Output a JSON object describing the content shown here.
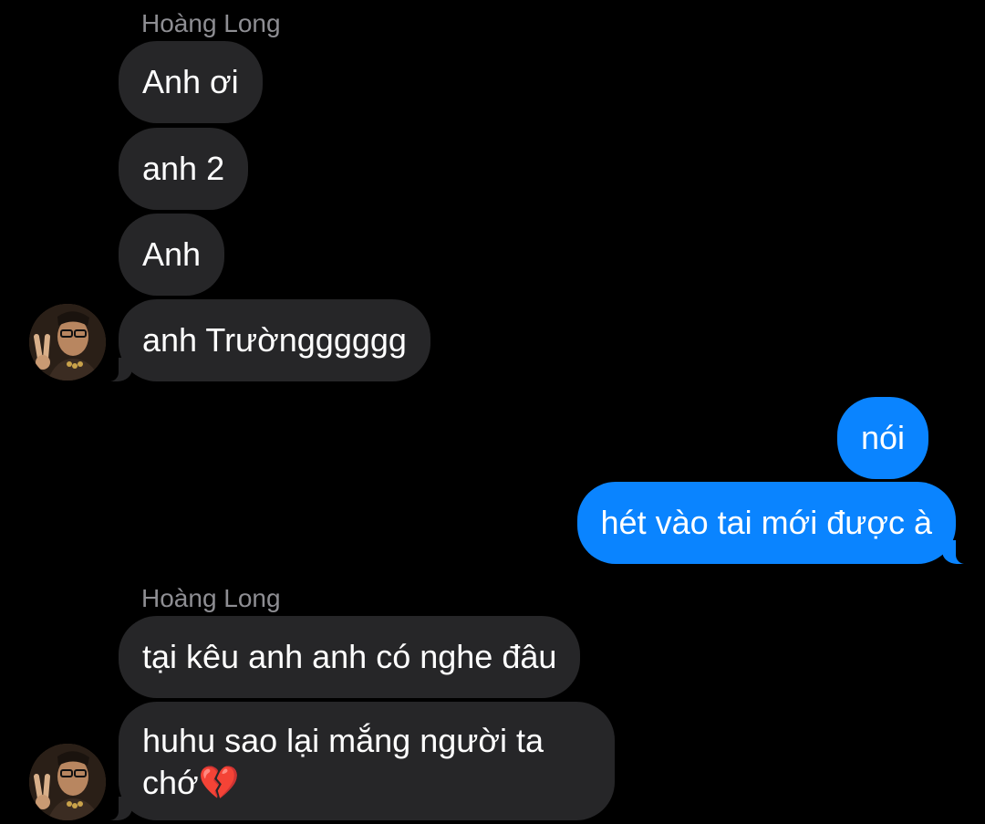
{
  "conversation": {
    "groups": [
      {
        "sender": "Hoàng Long",
        "messages": [
          "Anh ơi",
          "anh 2",
          "Anh",
          "anh Trườngggggg"
        ]
      },
      {
        "direction": "outgoing",
        "messages": [
          "nói",
          "hét vào tai mới được à"
        ]
      },
      {
        "sender": "Hoàng Long",
        "messages": [
          "tại kêu anh anh có nghe đâu",
          "huhu sao lại mắng người ta chớ💔"
        ]
      }
    ]
  },
  "colors": {
    "background": "#000000",
    "incoming_bubble": "#262628",
    "outgoing_bubble": "#0a84ff",
    "sender_name": "#8e8e93",
    "text": "#ffffff"
  },
  "icons": {
    "avatar": "contact-avatar"
  }
}
